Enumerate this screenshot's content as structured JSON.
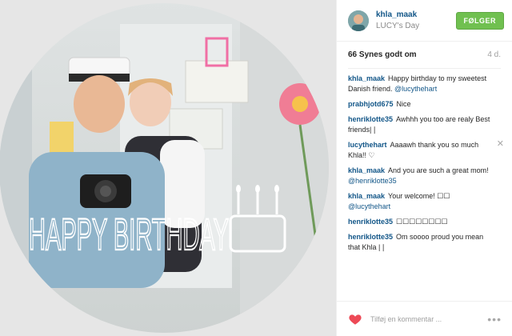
{
  "post": {
    "username": "khla_maak",
    "location": "LUCY's Day",
    "follow_label": "FØLGER",
    "likes": "66 Synes godt om",
    "time_ago": "4 d.",
    "photo_overlay_text": "HAPPY BIRTHDAY"
  },
  "comments": [
    {
      "user": "khla_maak",
      "text": "Happy birthday to my sweetest Danish friend. ",
      "mention": "@lucythehart",
      "tail": ""
    },
    {
      "user": "prabhjotd675",
      "text": "Nice",
      "mention": "",
      "tail": ""
    },
    {
      "user": "henriklotte35",
      "text": "Awhhh you too are realy Best friends|❘",
      "mention": "",
      "tail": ""
    },
    {
      "user": "lucythehart",
      "text": "Aaaawh thank you so much Khla!! ♡",
      "mention": "",
      "tail": ""
    },
    {
      "user": "khla_maak",
      "text": "And you are such a great mom! ",
      "mention": "@henriklotte35",
      "tail": ""
    },
    {
      "user": "khla_maak",
      "text": "Your welcome! ☐☐ ",
      "mention": "@lucythehart",
      "tail": ""
    },
    {
      "user": "henriklotte35",
      "text": "☐☐☐☐☐☐☐☐",
      "mention": "",
      "tail": ""
    },
    {
      "user": "henriklotte35",
      "text": "Om soooo proud you mean that Khla |❘",
      "mention": "",
      "tail": ""
    }
  ],
  "footer": {
    "comment_placeholder": "Tilføj en kommentar ...",
    "more_label": "•••"
  },
  "icons": {
    "delete": "close-icon",
    "like": "heart-icon",
    "more": "more-options-icon"
  },
  "colors": {
    "follow_green": "#70c050",
    "link_blue": "#125688",
    "heart_red": "#ed4956"
  }
}
